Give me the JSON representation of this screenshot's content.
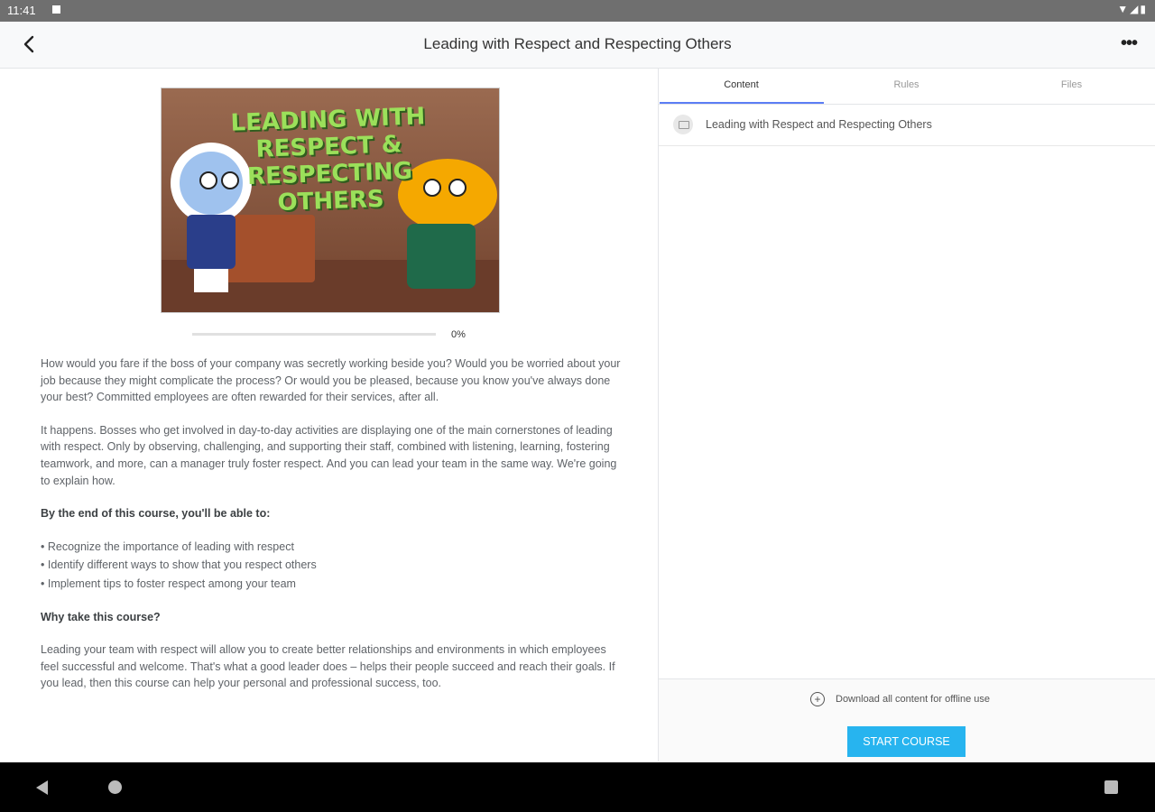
{
  "status_bar": {
    "time": "11:41",
    "icons": [
      "notification-icon",
      "wifi-icon",
      "signal-icon",
      "battery-icon"
    ]
  },
  "app_bar": {
    "title": "Leading with Respect and Respecting Others",
    "back_icon": "arrow-left-icon",
    "more_icon": "more-horizontal-icon"
  },
  "course": {
    "thumbnail_title": "LEADING WITH RESPECT & RESPECTING OTHERS",
    "progress_percent": 0,
    "progress_label": "0%",
    "description": {
      "p1": "How would you fare if the boss of your company was secretly working beside you? Would you be worried about your job because they might complicate the process? Or would you be pleased, because you know you've always done your best? Committed employees are often rewarded for their services, after all.",
      "p2": "It happens. Bosses who get involved in day-to-day activities are displaying one of the main cornerstones of leading with respect. Only by observing, challenging, and supporting their staff, combined with listening, learning, fostering teamwork, and more, can a manager truly foster respect. And you can lead your team in the same way. We're going to explain how.",
      "objectives_heading": "By the end of this course, you'll be able to:",
      "objectives": [
        "• Recognize the importance of leading with respect",
        "• Identify different ways to show that you respect others",
        "• Implement tips to foster respect among your team"
      ],
      "why_heading": "Why take this course?",
      "p3": "Leading your team with respect will allow you to create better relationships and environments in which employees feel successful and welcome. That's what a good leader does – helps their people succeed and reach their goals. If you lead, then this course can help your personal and professional success, too."
    }
  },
  "tabs": [
    {
      "label": "Content",
      "active": true
    },
    {
      "label": "Rules",
      "active": false
    },
    {
      "label": "Files",
      "active": false
    }
  ],
  "content_list": [
    {
      "label": "Leading with Respect and Respecting Others",
      "icon": "presentation-icon"
    }
  ],
  "footer": {
    "download_label": "Download all content for offline use",
    "start_button": "START COURSE"
  },
  "colors": {
    "accent": "#27b4ef",
    "tab_indicator": "#5b7df5",
    "status_bar": "#6f6f6f"
  }
}
